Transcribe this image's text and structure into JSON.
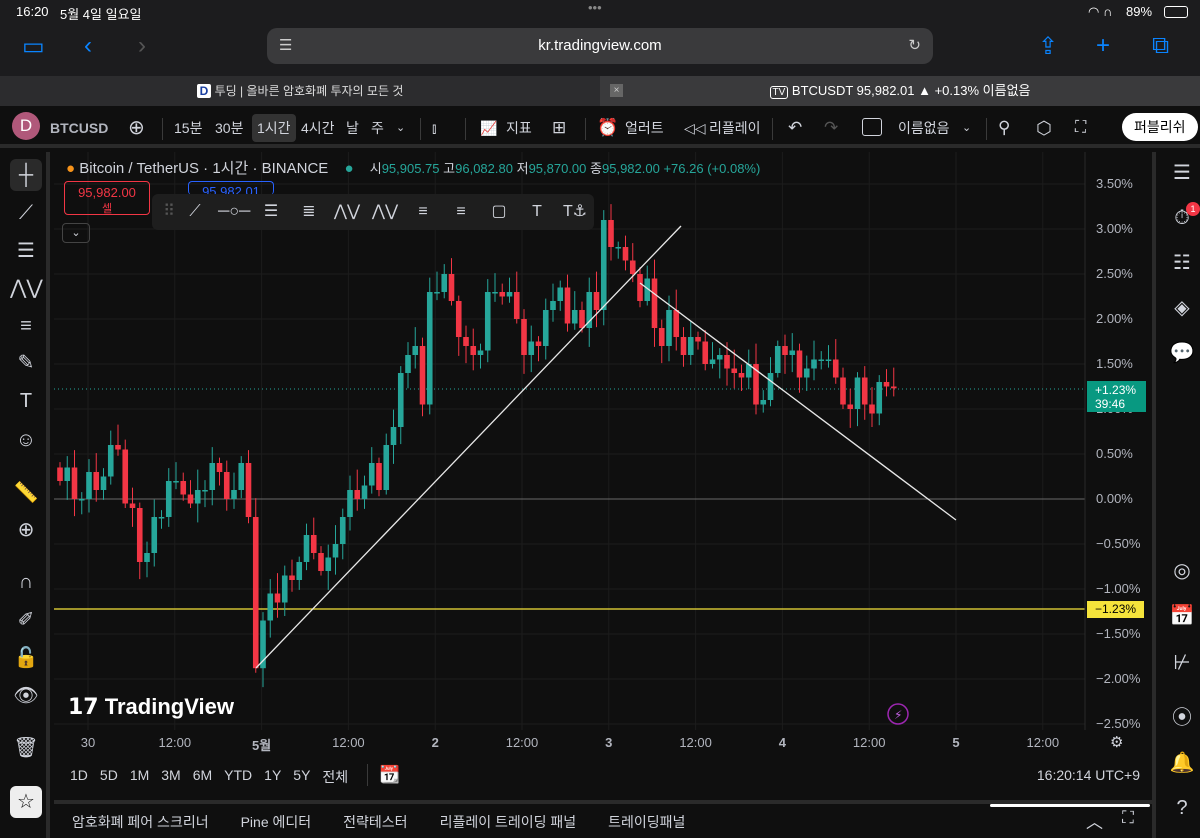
{
  "status": {
    "time": "16:20",
    "date": "5월 4일 일요일",
    "battery": "89%"
  },
  "browser": {
    "url": "kr.tradingview.com",
    "tabs": [
      {
        "title": "투딩 | 올바른 암호화폐 투자의 모든 것"
      },
      {
        "title": "BTCUSDT 95,982.01 ▲ +0.13% 이름없음"
      }
    ]
  },
  "toolbar": {
    "avatar": "D",
    "symbol": "BTCUSD",
    "intervals": [
      "15분",
      "30분",
      "1시간",
      "4시간",
      "날",
      "주"
    ],
    "active_interval": "1시간",
    "indicators": "지표",
    "alert": "얼러트",
    "replay": "리플레이",
    "layout_name": "이름없음",
    "publish": "퍼블리쉬"
  },
  "legend": {
    "title": "Bitcoin / TetherUS · 1시간 · BINANCE",
    "o_label": "시",
    "o": "95,905.75",
    "h_label": "고",
    "h": "96,082.80",
    "l_label": "저",
    "l": "95,870.00",
    "c_label": "종",
    "c": "95,982.00",
    "change": "+76.26 (+0.08%)",
    "sell_price": "95,982.00",
    "sell_label": "셀",
    "buy_price": "95,982.01"
  },
  "price_axis": {
    "labels": [
      "3.50%",
      "3.00%",
      "2.50%",
      "2.00%",
      "1.50%",
      "1.00%",
      "0.50%",
      "0.00%",
      "−0.50%",
      "−1.00%",
      "−1.50%",
      "−2.00%",
      "−2.50%"
    ],
    "current": "+1.23%",
    "countdown": "39:46",
    "line_label": "−1.23%"
  },
  "time_axis": {
    "labels": [
      "30",
      "12:00",
      "5월",
      "12:00",
      "2",
      "12:00",
      "3",
      "12:00",
      "4",
      "12:00",
      "5",
      "12:00"
    ]
  },
  "range": {
    "buttons": [
      "1D",
      "5D",
      "1M",
      "3M",
      "6M",
      "YTD",
      "1Y",
      "5Y",
      "전체"
    ],
    "clock": "16:20:14 UTC+9"
  },
  "bottom": {
    "tabs": [
      "암호화폐 페어 스크리너",
      "Pine 에디터",
      "전략테스터",
      "리플레이 트레이딩 패널",
      "트레이딩패널"
    ]
  },
  "watermark": "TradingView",
  "alerts_badge": "1",
  "colors": {
    "up": "#26a69a",
    "down": "#f23645",
    "accent": "#2962ff",
    "hline": "#f5e33b"
  },
  "chart_data": {
    "type": "candlestick",
    "unit": "%",
    "ylim": [
      -2.5,
      3.5
    ],
    "closes": [
      0.2,
      0.35,
      0.0,
      0.0,
      0.3,
      0.1,
      0.25,
      0.6,
      0.55,
      -0.05,
      -0.1,
      -0.7,
      -0.6,
      -0.2,
      -0.2,
      0.2,
      0.2,
      0.05,
      -0.05,
      0.1,
      0.1,
      0.4,
      0.3,
      0.0,
      0.1,
      0.4,
      -0.2,
      -1.88,
      -1.35,
      -1.05,
      -1.15,
      -0.85,
      -0.9,
      -0.7,
      -0.4,
      -0.6,
      -0.8,
      -0.65,
      -0.5,
      -0.2,
      0.1,
      0.0,
      0.15,
      0.4,
      0.1,
      0.6,
      0.8,
      1.4,
      1.6,
      1.7,
      1.05,
      2.3,
      2.3,
      2.5,
      2.2,
      1.8,
      1.7,
      1.6,
      1.65,
      2.3,
      2.3,
      2.25,
      2.3,
      2.0,
      1.6,
      1.75,
      1.7,
      2.1,
      2.2,
      2.35,
      1.95,
      2.1,
      1.9,
      2.3,
      2.1,
      3.1,
      2.8,
      2.8,
      2.65,
      2.5,
      2.2,
      2.45,
      1.9,
      1.7,
      2.1,
      1.8,
      1.6,
      1.8,
      1.75,
      1.5,
      1.55,
      1.6,
      1.45,
      1.4,
      1.35,
      1.5,
      1.05,
      1.1,
      1.4,
      1.7,
      1.6,
      1.65,
      1.35,
      1.45,
      1.55,
      1.55,
      1.55,
      1.35,
      1.05,
      1.0,
      1.35,
      1.05,
      0.95,
      1.3,
      1.25,
      1.23
    ],
    "horizontal_line": -1.23,
    "current_value": 1.23
  }
}
